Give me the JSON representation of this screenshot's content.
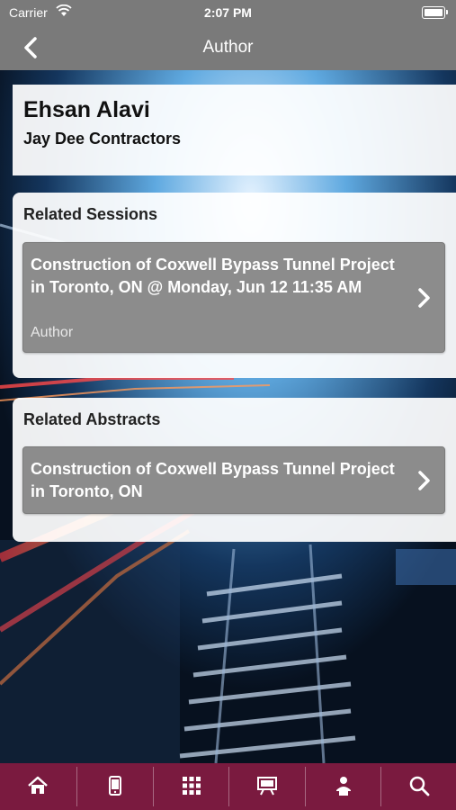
{
  "status_bar": {
    "carrier": "Carrier",
    "time": "2:07 PM"
  },
  "nav": {
    "title": "Author"
  },
  "author": {
    "name": "Ehsan Alavi",
    "organization": "Jay Dee Contractors"
  },
  "related_sessions": {
    "heading": "Related Sessions",
    "items": [
      {
        "title": "Construction of Coxwell Bypass Tunnel Project in Toronto, ON @ Monday, Jun 12 11:35 AM",
        "subtitle": "Author"
      }
    ]
  },
  "related_abstracts": {
    "heading": "Related Abstracts",
    "items": [
      {
        "title": "Construction of Coxwell Bypass Tunnel Project in Toronto, ON"
      }
    ]
  },
  "tab_bar": {
    "tabs": [
      "home-icon",
      "mobile-icon",
      "grid-icon",
      "presentation-icon",
      "speaker-icon",
      "search-icon"
    ]
  },
  "colors": {
    "bars": "#7a7a7a",
    "tab_bar": "#7a1a3f",
    "item": "#8c8c8c"
  }
}
